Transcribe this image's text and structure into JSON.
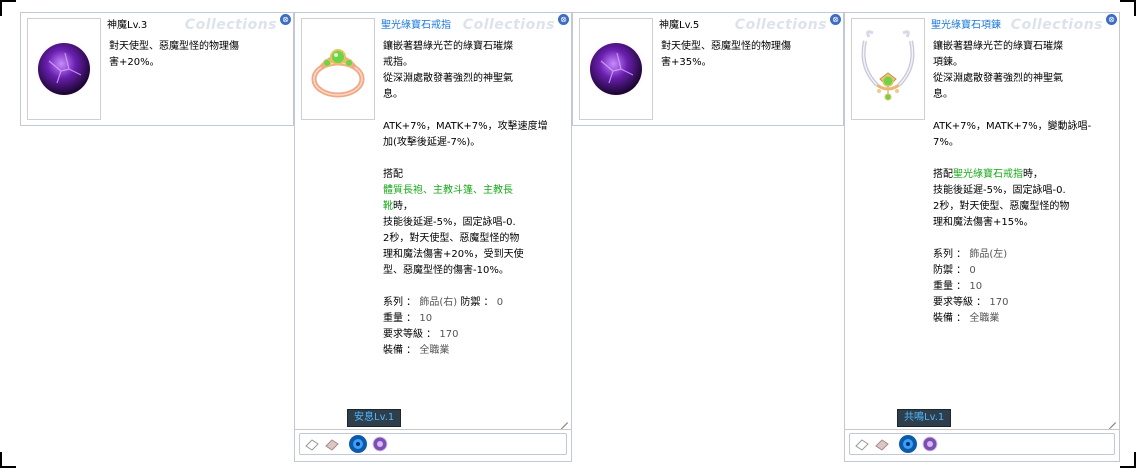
{
  "watermark": "Collections",
  "close_glyph": "⊗",
  "cards": [
    {
      "title": "神魔Lv.3",
      "lines": [
        "對天使型、惡魔型怪的物理傷",
        "害+20%。"
      ]
    },
    {
      "title": "聖光綠寶石戒指",
      "intro": [
        "鑲嵌著碧綠光芒的綠寶石璀燦",
        "戒指。",
        "從深淵處散發著強烈的神聖氣",
        "息。"
      ],
      "stats": [
        "ATK+7%，MATK+7%，攻擊速度增",
        "加(攻擊後延遲-7%)。"
      ],
      "set_header": "搭配",
      "set_items": [
        "體質長袍、主教斗篷、主教長",
        "靴"
      ],
      "set_suffix": "時，",
      "set_effect": [
        "技能後延遲-5%，固定詠唱-0.",
        "2秒，對天使型、惡魔型怪的物",
        "理和魔法傷害+20%，受到天使",
        "型、惡魔型怪的傷害-10%。"
      ],
      "info": {
        "type_label": "系列 ：",
        "type_value": "飾品(右)",
        "def_label": "防禦 ：",
        "def_value": "0",
        "weight_label": "重量 ：",
        "weight_value": "10",
        "level_label": "要求等級 ：",
        "level_value": "170",
        "job_label": "裝備 ：",
        "job_value": "全職業"
      },
      "skill_tab": "安息Lv.1"
    },
    {
      "title": "神魔Lv.5",
      "lines": [
        "對天使型、惡魔型怪的物理傷",
        "害+35%。"
      ]
    },
    {
      "title": "聖光綠寶石項鍊",
      "intro": [
        "鑲嵌著碧綠光芒的綠寶石璀燦",
        "項鍊。",
        "從深淵處散發著強烈的神聖氣",
        "息。"
      ],
      "stats": [
        "ATK+7%，MATK+7%，變動詠唱-",
        "7%。"
      ],
      "set_header": "搭配",
      "set_items": "聖光綠寶石戒指",
      "set_suffix": "時，",
      "set_effect": [
        "技能後延遲-5%，固定詠唱-0.",
        "2秒，對天使型、惡魔型怪的物",
        "理和魔法傷害+15%。"
      ],
      "info": {
        "type_label": "系列 ：",
        "type_value": "飾品(左)",
        "def_label": "防禦 ：",
        "def_value": "0",
        "weight_label": "重量 ：",
        "weight_value": "10",
        "level_label": "要求等級 ：",
        "level_value": "170",
        "job_label": "裝備 ：",
        "job_value": "全職業"
      },
      "skill_tab": "共鳴Lv.1"
    }
  ],
  "icons": {
    "orb": "dark-purple-orb-icon",
    "ring": "emerald-ring-icon",
    "necklace": "emerald-necklace-icon",
    "slot_card": "card-slot-icon",
    "slot_blue": "blue-orb-slot-icon",
    "slot_purple": "purple-orb-slot-icon"
  },
  "colors": {
    "title_blue": "#1a78d8",
    "set_green": "#18a818",
    "skill_tab_bg": "#2e3e4a",
    "skill_tab_text": "#4fb6ff"
  }
}
